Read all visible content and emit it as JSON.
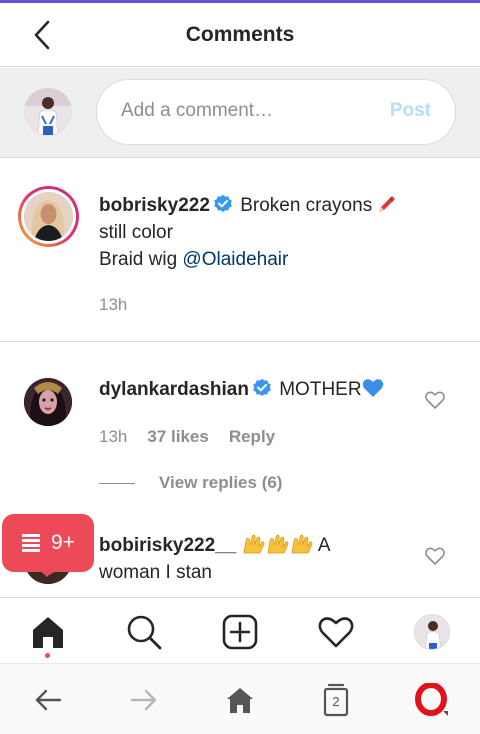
{
  "header": {
    "title": "Comments"
  },
  "composer": {
    "placeholder": "Add a comment…",
    "post_label": "Post"
  },
  "caption": {
    "username": "bobrisky222",
    "text_line1": "Broken crayons",
    "text_line2": "still color",
    "text_line3_prefix": "Braid wig ",
    "mention": "@Olaidehair",
    "time": "13h"
  },
  "comments": [
    {
      "username": "dylankardashian",
      "text": "MOTHER",
      "time": "13h",
      "likes": "37 likes",
      "reply_label": "Reply",
      "view_replies": "View replies (6)"
    },
    {
      "username": "bobirisky222__",
      "text_after": "A",
      "text_line2": "woman I stan"
    }
  ],
  "notification": {
    "count": "9+"
  },
  "browser": {
    "tabs_count": "2"
  },
  "colors": {
    "accent_purple": "#6b4fd8",
    "notification_red": "#ed4956",
    "post_disabled": "#b2dffc",
    "verified_blue": "#3897f0",
    "mention": "#00376b"
  },
  "icons": {
    "back": "chevron-left-icon",
    "home": "home-icon",
    "search": "search-icon",
    "new_post": "add-post-icon",
    "activity": "heart-icon",
    "verified": "verified-badge-icon"
  }
}
